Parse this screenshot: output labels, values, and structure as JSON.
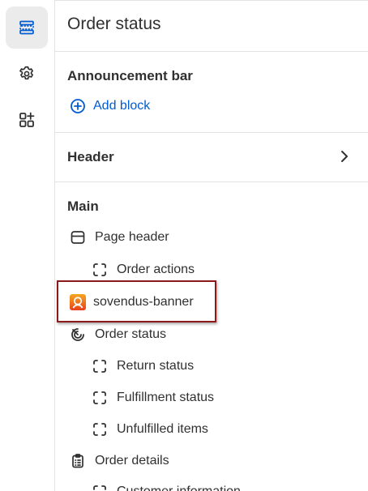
{
  "sidebar": {
    "items": [
      {
        "name": "sections-icon",
        "active": true
      },
      {
        "name": "settings-icon",
        "active": false
      },
      {
        "name": "apps-icon",
        "active": false
      }
    ]
  },
  "panel": {
    "title": "Order status",
    "announcement": {
      "title": "Announcement bar",
      "add_block_label": "Add block"
    },
    "header": {
      "title": "Header"
    },
    "main": {
      "title": "Main",
      "items": [
        {
          "label": "Page header",
          "icon": "page-header-icon",
          "level": 1
        },
        {
          "label": "Order actions",
          "icon": "dashed-block-icon",
          "level": 2
        },
        {
          "label": "sovendus-banner",
          "icon": "sovendus-app-icon",
          "level": 1,
          "highlighted": true
        },
        {
          "label": "Order status",
          "icon": "order-status-icon",
          "level": 1
        },
        {
          "label": "Return status",
          "icon": "dashed-block-icon",
          "level": 2
        },
        {
          "label": "Fulfillment status",
          "icon": "dashed-block-icon",
          "level": 2
        },
        {
          "label": "Unfulfilled items",
          "icon": "dashed-block-icon",
          "level": 2
        },
        {
          "label": "Order details",
          "icon": "clipboard-icon",
          "level": 1
        },
        {
          "label": "Customer information",
          "icon": "dashed-block-icon",
          "level": 2
        }
      ]
    }
  },
  "colors": {
    "accent": "#005bd3",
    "highlight_border": "#8b1a1a",
    "text": "#303030",
    "divider": "#e3e3e3"
  }
}
